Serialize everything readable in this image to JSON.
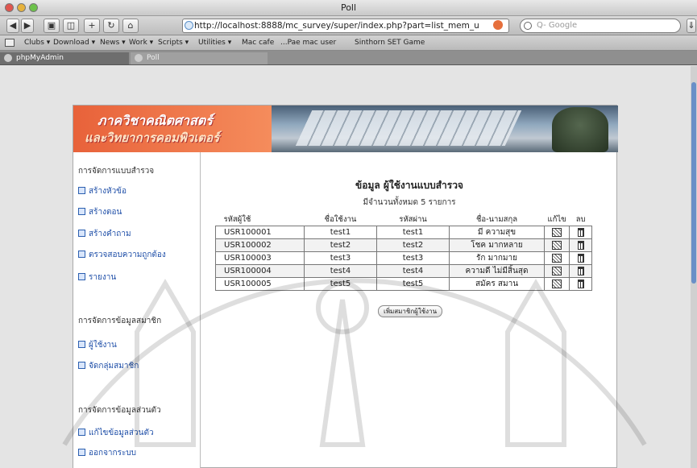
{
  "window": {
    "title": "Poll"
  },
  "toolbar": {
    "url": "http://localhost:8888/mc_survey/super/index.php?part=list_mem_u",
    "search_placeholder": "Q- Google"
  },
  "bookmarks": {
    "items": [
      "Clubs ▾",
      "Download ▾",
      "News ▾",
      "Work ▾",
      "Scripts ▾",
      "Utilities ▾",
      "Mac cafe",
      "...Pae mac user",
      "Sinthorn SET Game"
    ]
  },
  "tabs": [
    {
      "label": "phpMyAdmin"
    },
    {
      "label": "Poll"
    }
  ],
  "banner": {
    "line1": "ภาควิชาคณิตศาสตร์",
    "line2": "และวิทยาการคอมพิวเตอร์"
  },
  "sidebar": {
    "sections": [
      {
        "heading": "การจัดการแบบสำรวจ",
        "items": [
          "สร้างหัวข้อ",
          "สร้างตอน",
          "สร้างคำถาม",
          "ตรวจสอบความถูกต้อง",
          "รายงาน"
        ]
      },
      {
        "heading": "การจัดการข้อมูลสมาชิก",
        "items": [
          "ผู้ใช้งาน",
          "จัดกลุ่มสมาชิก"
        ]
      },
      {
        "heading": "การจัดการข้อมูลส่วนตัว",
        "items": [
          "แก้ไขข้อมูลส่วนตัว",
          "ออกจากระบบ"
        ]
      }
    ]
  },
  "main": {
    "title": "ข้อมูล ผู้ใช้งานแบบสำรวจ",
    "count_text": "มีจำนวนทั้งหมด 5 รายการ",
    "add_button": "เพิ่มสมาชิกผู้ใช้งาน",
    "columns": [
      "รหัสผู้ใช้",
      "ชื่อใช้งาน",
      "รหัสผ่าน",
      "ชื่อ-นามสกุล",
      "แก้ไข",
      "ลบ"
    ],
    "rows": [
      {
        "id": "USR100001",
        "username": "test1",
        "password": "test1",
        "fullname": "มี ความสุข"
      },
      {
        "id": "USR100002",
        "username": "test2",
        "password": "test2",
        "fullname": "โชค มากหลาย"
      },
      {
        "id": "USR100003",
        "username": "test3",
        "password": "test3",
        "fullname": "รัก มากมาย"
      },
      {
        "id": "USR100004",
        "username": "test4",
        "password": "test4",
        "fullname": "ความดี ไม่มีสิ้นสุด"
      },
      {
        "id": "USR100005",
        "username": "test5",
        "password": "test5",
        "fullname": "สมัคร สมาน"
      }
    ]
  }
}
